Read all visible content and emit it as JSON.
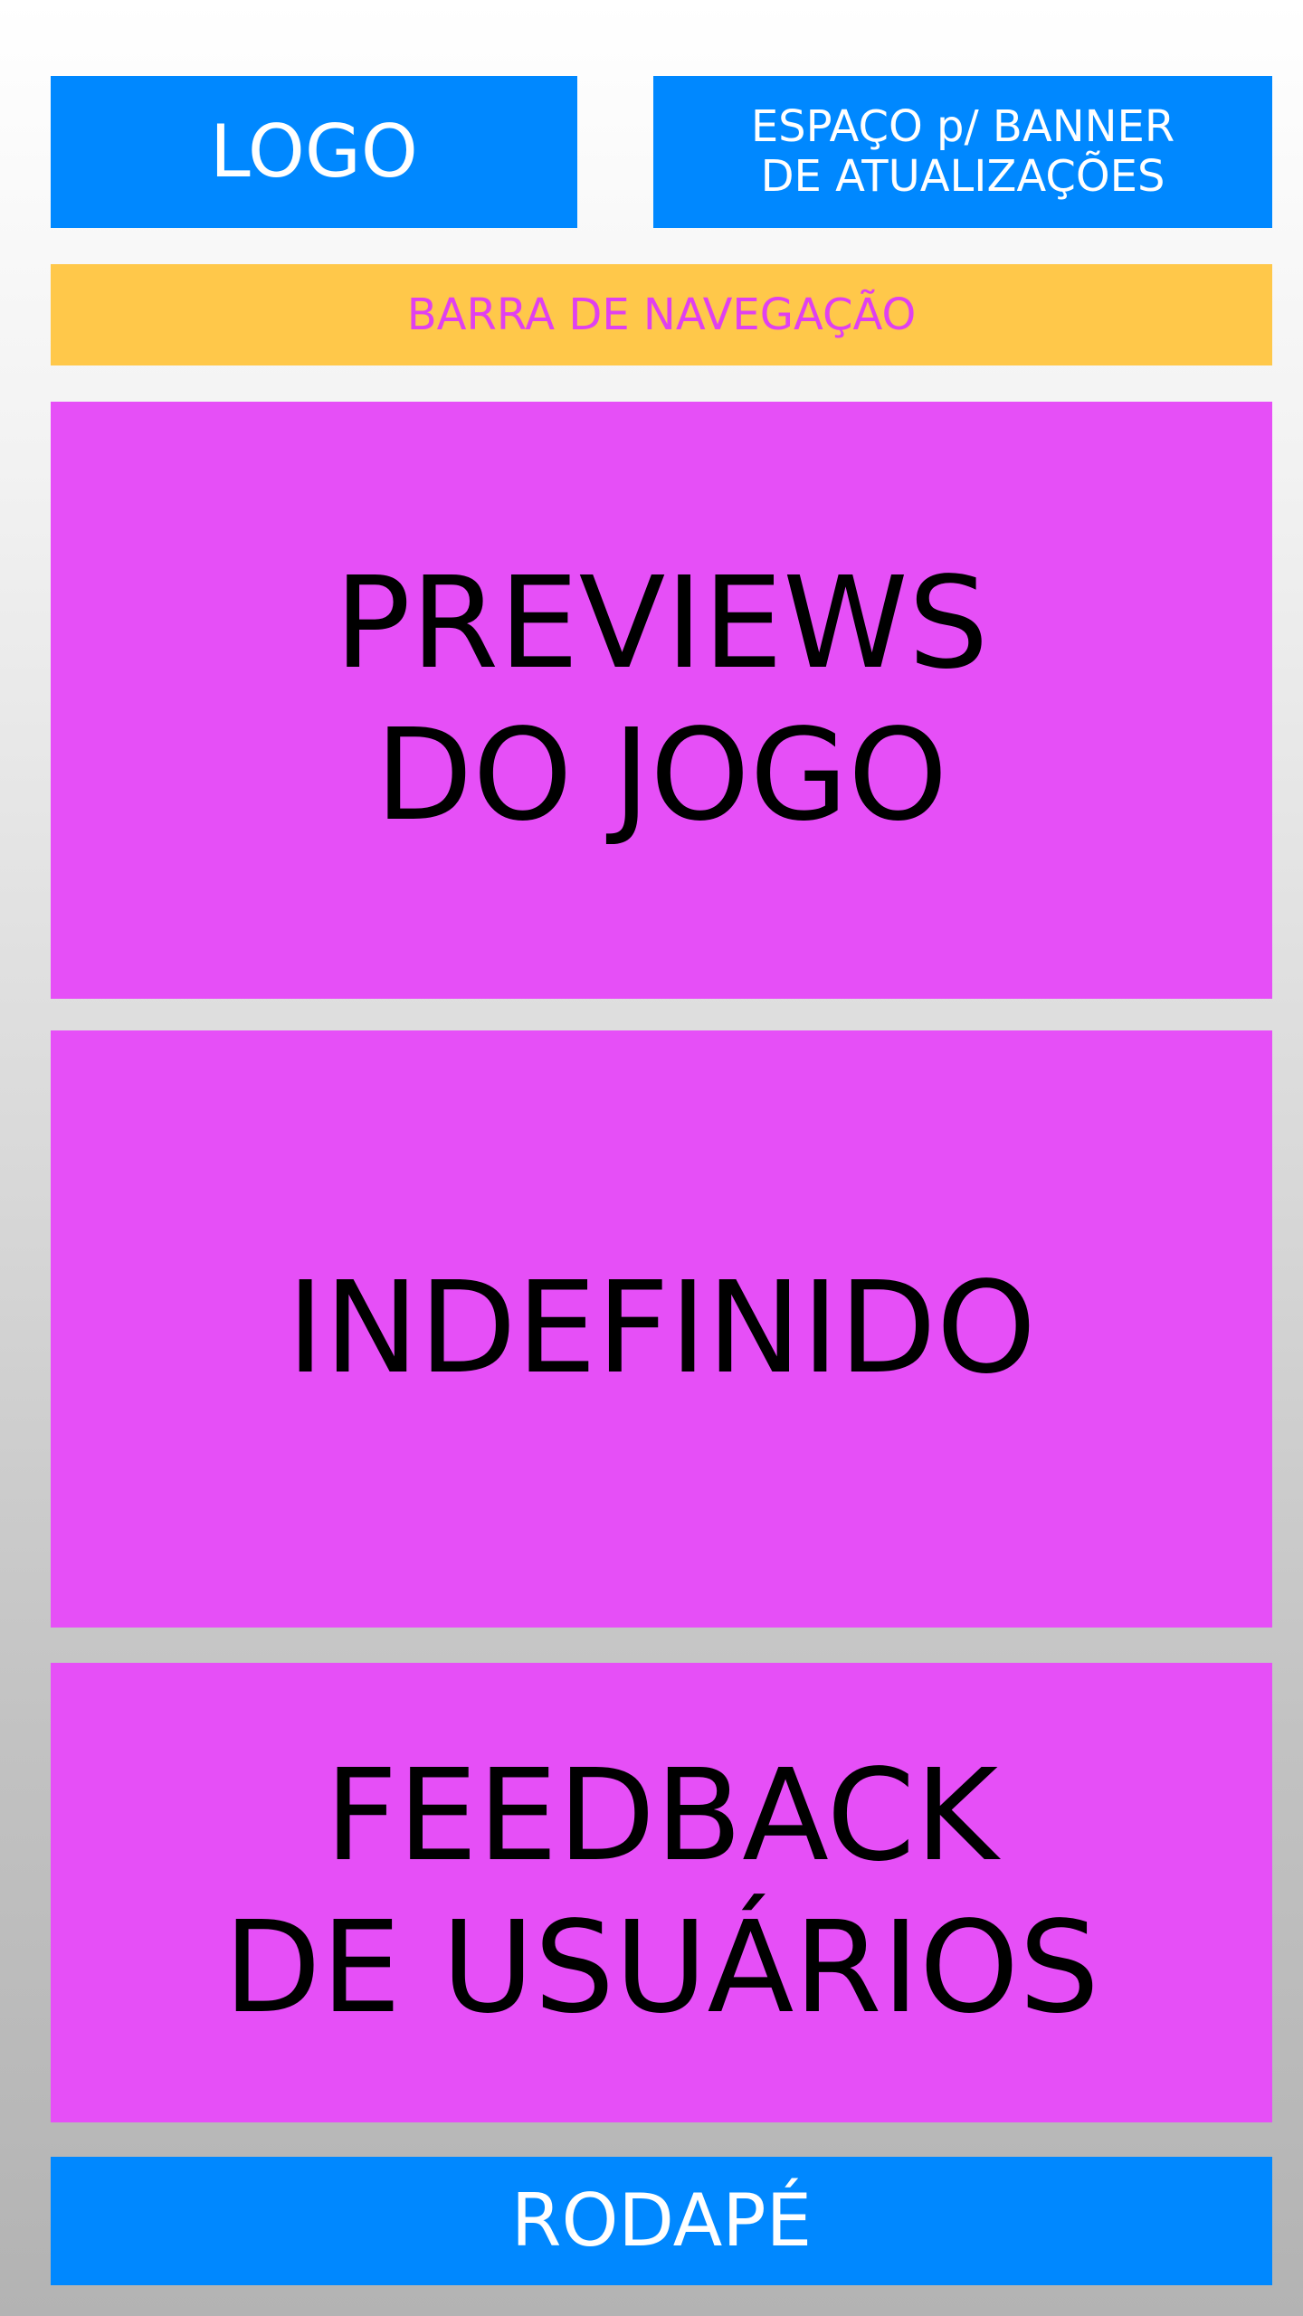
{
  "header": {
    "logo": "LOGO",
    "banner": "ESPAÇO p/ BANNER\nDE ATUALIZAÇÕES"
  },
  "nav": {
    "label": "BARRA DE NAVEGAÇÃO"
  },
  "sections": {
    "previews": "PREVIEWS\nDO JOGO",
    "undefined_block": "INDEFINIDO",
    "feedback": "FEEDBACK\nDE USUÁRIOS"
  },
  "footer": {
    "label": "RODAPÉ"
  },
  "colors": {
    "blue": "#0088ff",
    "yellow": "#ffc84a",
    "magenta": "#e64ff7",
    "nav_text": "#e040f0"
  }
}
